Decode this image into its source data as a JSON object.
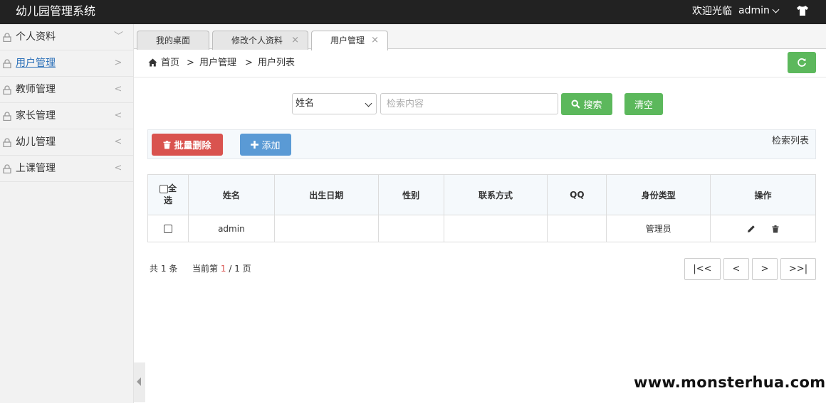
{
  "header": {
    "app_title": "幼儿园管理系统",
    "welcome_text": "欢迎光临",
    "username": "admin"
  },
  "sidebar": {
    "items": [
      {
        "label": "个人资料",
        "arrow": "﹀",
        "active": false
      },
      {
        "label": "用户管理",
        "arrow": ">",
        "active": true
      },
      {
        "label": "教师管理",
        "arrow": "<",
        "active": false
      },
      {
        "label": "家长管理",
        "arrow": "<",
        "active": false
      },
      {
        "label": "幼儿管理",
        "arrow": "<",
        "active": false
      },
      {
        "label": "上课管理",
        "arrow": "<",
        "active": false
      }
    ]
  },
  "tabs": [
    {
      "label": "我的桌面",
      "closable": false
    },
    {
      "label": "修改个人资料",
      "close": "×"
    },
    {
      "label": "用户管理",
      "close": "×",
      "active": true
    }
  ],
  "breadcrumb": {
    "home": "首页",
    "separator": ">",
    "level1": "用户管理",
    "level2": "用户列表"
  },
  "search": {
    "field_selected": "姓名",
    "placeholder": "检索内容",
    "search_label": "搜索",
    "clear_label": "清空"
  },
  "toolbar": {
    "batch_delete_label": "批量删除",
    "add_label": "添加",
    "list_label": "检索列表"
  },
  "table": {
    "select_all_line1": "全",
    "select_all_line2": "选",
    "columns": [
      "姓名",
      "出生日期",
      "性别",
      "联系方式",
      "QQ",
      "身份类型",
      "操作"
    ],
    "rows": [
      {
        "name": "admin",
        "birth_date": "",
        "gender": "",
        "contact": "",
        "qq": "",
        "identity": "管理员"
      }
    ]
  },
  "pagination": {
    "total_prefix": "共",
    "total_count": "1",
    "total_suffix": "条",
    "current_prefix": "当前第",
    "current_page": "1",
    "page_sep": "/",
    "total_pages": "1",
    "page_suffix": "页",
    "first_label": "|<<",
    "prev_label": "<",
    "next_label": ">",
    "last_label": ">>|"
  },
  "watermark": "www.monsterhua.com",
  "colors": {
    "topbar": "#222222",
    "success": "#5cb85c",
    "danger": "#d9534f",
    "primary": "#5a9ad5",
    "link": "#2a6fb8"
  },
  "icons": {
    "user_menu": "chevron-down-icon",
    "theme": "shirt-icon",
    "sidebar": "lock-icon",
    "breadcrumb": "home-icon",
    "refresh": "refresh-icon",
    "search": "search-icon",
    "batch_delete": "trash-icon",
    "add": "plus-icon",
    "edit": "pencil-icon",
    "delete": "trash-icon"
  }
}
